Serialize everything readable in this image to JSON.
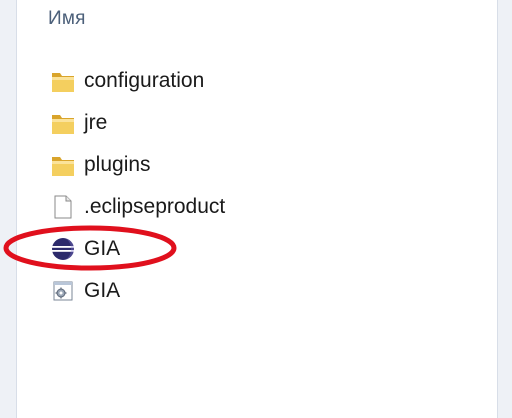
{
  "column_header": "Имя",
  "files": [
    {
      "name": "configuration",
      "icon": "folder-icon"
    },
    {
      "name": "jre",
      "icon": "folder-icon"
    },
    {
      "name": "plugins",
      "icon": "folder-icon"
    },
    {
      "name": ".eclipseproduct",
      "icon": "document-icon"
    },
    {
      "name": "GIA",
      "icon": "eclipse-app-icon"
    },
    {
      "name": "GIA",
      "icon": "config-settings-icon"
    }
  ],
  "colors": {
    "highlight": "#e0101d",
    "folder": "#e9b93a",
    "eclipse_blue": "#2c2a6b"
  }
}
